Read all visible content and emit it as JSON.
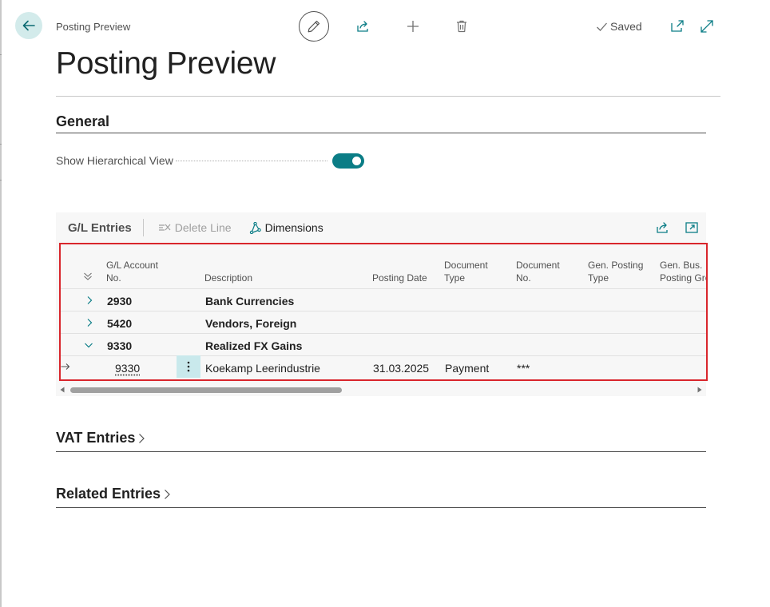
{
  "header": {
    "breadcrumb": "Posting Preview",
    "saved_label": "Saved"
  },
  "page": {
    "title": "Posting Preview"
  },
  "general": {
    "heading": "General",
    "show_hierarchical_label": "Show Hierarchical View",
    "show_hierarchical_value": true
  },
  "gl_entries": {
    "title": "G/L Entries",
    "actions": {
      "delete_line": "Delete Line",
      "dimensions": "Dimensions"
    },
    "columns": {
      "gl_account_no_1": "G/L Account",
      "gl_account_no_2": "No.",
      "description": "Description",
      "posting_date": "Posting Date",
      "document_type_1": "Document",
      "document_type_2": "Type",
      "document_no_1": "Document",
      "document_no_2": "No.",
      "gen_posting_type_1": "Gen. Posting",
      "gen_posting_type_2": "Type",
      "gen_bus_posting_group_1": "Gen. Bus.",
      "gen_bus_posting_group_2": "Posting Gro"
    },
    "rows": [
      {
        "account": "2930",
        "description": "Bank Currencies",
        "expanded": false
      },
      {
        "account": "5420",
        "description": "Vendors, Foreign",
        "expanded": false
      },
      {
        "account": "9330",
        "description": "Realized FX Gains",
        "expanded": true
      },
      {
        "account": "9330",
        "description": "Koekamp Leerindustrie",
        "posting_date": "31.03.2025",
        "document_type": "Payment",
        "document_no": "***"
      }
    ]
  },
  "vat_entries": {
    "heading": "VAT Entries"
  },
  "related_entries": {
    "heading": "Related Entries"
  },
  "colors": {
    "accent": "#0b7d86",
    "highlight_border": "#d9262c",
    "back_button_bg": "#d3ebeb"
  }
}
